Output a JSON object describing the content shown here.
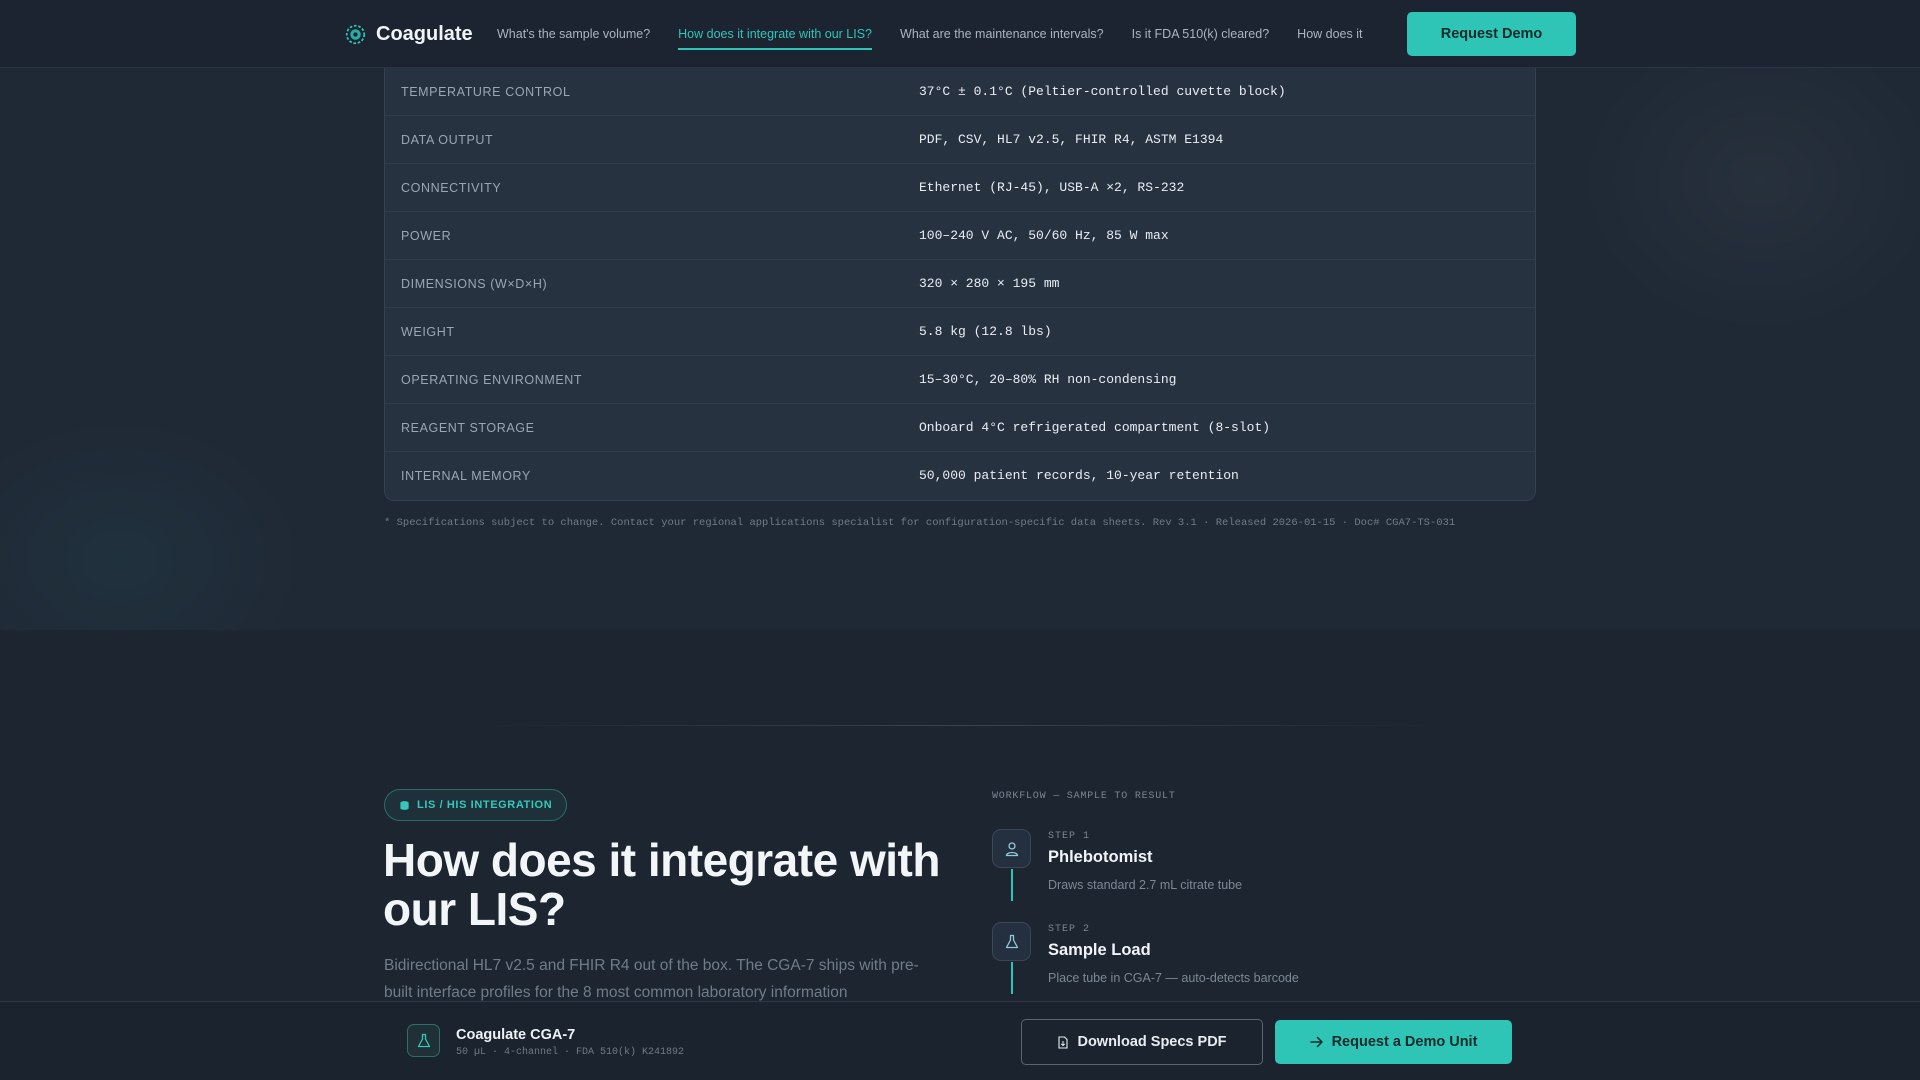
{
  "nav": {
    "brand": "Coagulate",
    "links": [
      "What's the sample volume?",
      "How does it integrate with our LIS?",
      "What are the maintenance intervals?",
      "Is it FDA 510(k) cleared?",
      "How does it"
    ],
    "active_link": "How does it integrate with our LIS?",
    "cta": "Request Demo",
    "accent_color": "#2ec4b6"
  },
  "specs": {
    "rows": [
      {
        "label": "Temperature Control",
        "value": "37°C ± 0.1°C (Peltier-controlled cuvette block)"
      },
      {
        "label": "Data Output",
        "value": "PDF, CSV, HL7 v2.5, FHIR R4, ASTM E1394"
      },
      {
        "label": "Connectivity",
        "value": "Ethernet (RJ-45), USB-A ×2, RS-232"
      },
      {
        "label": "Power",
        "value": "100–240 V AC, 50/60 Hz, 85 W max"
      },
      {
        "label": "Dimensions (W×D×H)",
        "value": "320 × 280 × 195 mm"
      },
      {
        "label": "Weight",
        "value": "5.8 kg (12.8 lbs)"
      },
      {
        "label": "Operating Environment",
        "value": "15–30°C, 20–80% RH non-condensing"
      },
      {
        "label": "Reagent Storage",
        "value": "Onboard 4°C refrigerated compartment (8-slot)"
      },
      {
        "label": "Internal Memory",
        "value": "50,000 patient records, 10-year retention"
      }
    ],
    "note": "* Specifications subject to change. Contact your regional applications specialist for configuration-specific data sheets. Rev 3.1 · Released 2026-01-15 · Doc# CGA7-TS-031"
  },
  "lis_section": {
    "badge": "LIS / HIS INTEGRATION",
    "title": "How does it integrate with our LIS?",
    "description": "Bidirectional HL7 v2.5 and FHIR R4 out of the box. The CGA-7 ships with pre-built interface profiles for the 8 most common laboratory information",
    "workflow_label": "WORKFLOW — SAMPLE TO RESULT",
    "steps": [
      {
        "num": "STEP 1",
        "title": "Phlebotomist",
        "desc": "Draws standard 2.7 mL citrate tube",
        "icon": "person-icon"
      },
      {
        "num": "STEP 2",
        "title": "Sample Load",
        "desc": "Place tube in CGA-7 — auto-detects barcode",
        "icon": "flask-icon"
      }
    ]
  },
  "bottom_bar": {
    "product_name": "Coagulate CGA-7",
    "product_meta": "50 µL · 4-channel · FDA 510(k) K241892",
    "download_label": "Download Specs PDF",
    "demo_label": "Request a Demo Unit"
  }
}
